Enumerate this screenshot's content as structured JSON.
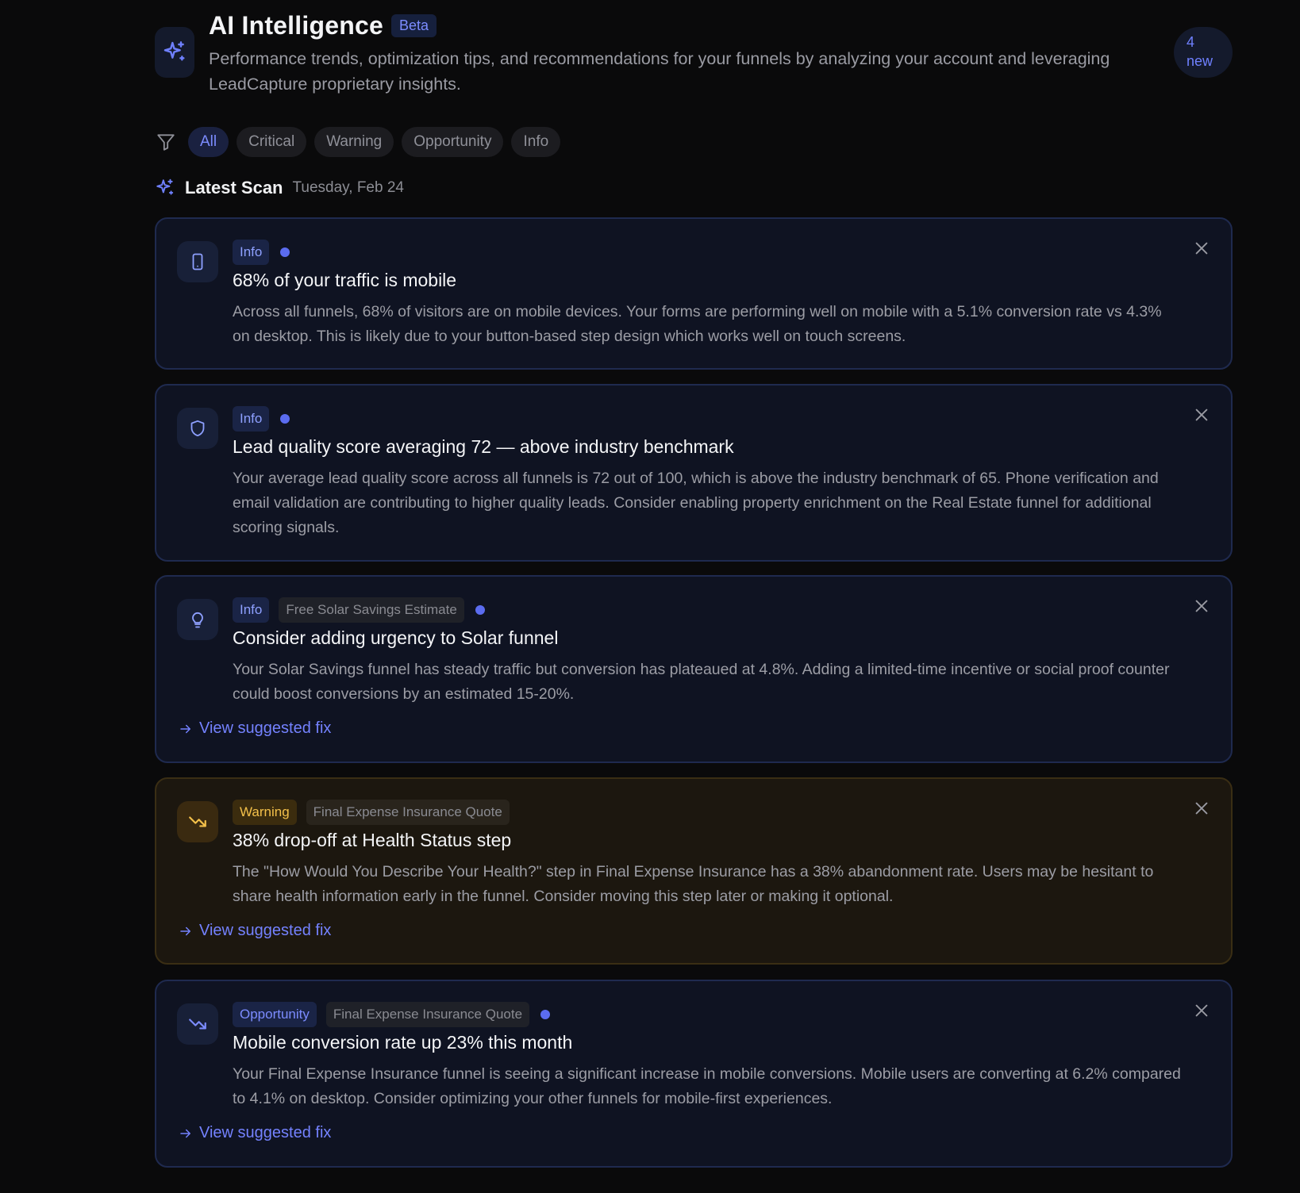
{
  "header": {
    "title": "AI Intelligence",
    "beta_label": "Beta",
    "subtitle": "Performance trends, optimization tips, and recommendations for your funnels by analyzing your account and leveraging LeadCapture proprietary insights.",
    "new_count": "4",
    "new_label": "new"
  },
  "filters": {
    "items": [
      "All",
      "Critical",
      "Warning",
      "Opportunity",
      "Info"
    ],
    "active": "All"
  },
  "scan": {
    "title": "Latest Scan",
    "date": "Tuesday, Feb 24"
  },
  "cards": [
    {
      "icon": "smartphone-icon",
      "tag": "Info",
      "funnel": "",
      "unread": true,
      "title": "68% of your traffic is mobile",
      "description": "Across all funnels, 68% of visitors are on mobile devices. Your forms are performing well on mobile with a 5.1% conversion rate vs 4.3% on desktop. This is likely due to your button-based step design which works well on touch screens.",
      "action": ""
    },
    {
      "icon": "shield-icon",
      "tag": "Info",
      "funnel": "",
      "unread": true,
      "title": "Lead quality score averaging 72 — above industry benchmark",
      "description": "Your average lead quality score across all funnels is 72 out of 100, which is above the industry benchmark of 65. Phone verification and email validation are contributing to higher quality leads. Consider enabling property enrichment on the Real Estate funnel for additional scoring signals.",
      "action": ""
    },
    {
      "icon": "lightbulb-icon",
      "tag": "Info",
      "funnel": "Free Solar Savings Estimate",
      "unread": true,
      "title": "Consider adding urgency to Solar funnel",
      "description": "Your Solar Savings funnel has steady traffic but conversion has plateaued at 4.8%. Adding a limited-time incentive or social proof counter could boost conversions by an estimated 15-20%.",
      "action": "View suggested fix"
    },
    {
      "icon": "trending-down-icon",
      "tag": "Warning",
      "funnel": "Final Expense Insurance Quote",
      "unread": false,
      "title": "38% drop-off at Health Status step",
      "description": "The \"How Would You Describe Your Health?\" step in Final Expense Insurance has a 38% abandonment rate. Users may be hesitant to share health information early in the funnel. Consider moving this step later or making it optional.",
      "action": "View suggested fix"
    },
    {
      "icon": "trending-down-icon",
      "tag": "Opportunity",
      "funnel": "Final Expense Insurance Quote",
      "unread": true,
      "title": "Mobile conversion rate up 23% this month",
      "description": "Your Final Expense Insurance funnel is seeing a significant increase in mobile conversions. Mobile users are converting at 6.2% compared to 4.1% on desktop. Consider optimizing your other funnels for mobile-first experiences.",
      "action": "View suggested fix"
    }
  ],
  "colors": {
    "accent": "#7482ff",
    "background": "#0a0a0b",
    "card_background": "#0f1322",
    "warning": "#f3c04a"
  }
}
